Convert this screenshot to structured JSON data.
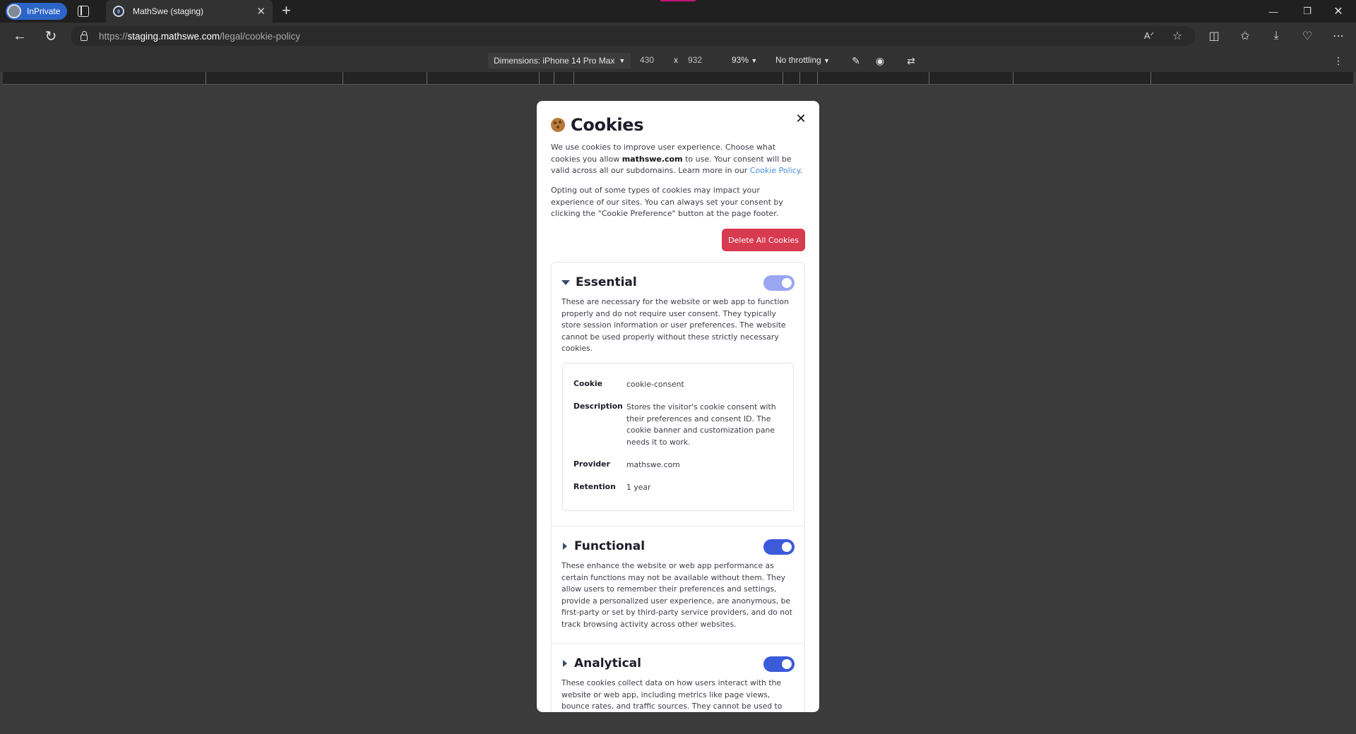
{
  "browser": {
    "profile_label": "InPrivate",
    "tab_title": "MathSwe (staging)",
    "url_scheme": "https://",
    "url_host": "staging.mathswe.com",
    "url_path": "/legal/cookie-policy"
  },
  "devtools": {
    "dimensions_label": "Dimensions: iPhone 14 Pro Max",
    "width": "430",
    "times": "x",
    "height": "932",
    "zoom": "93%",
    "throttling": "No throttling"
  },
  "modal": {
    "title": "Cookies",
    "intro_part1": "We use cookies to improve user experience. Choose what cookies you allow ",
    "intro_brand": "mathswe.com",
    "intro_part2": " to use. Your consent will be valid across all our subdomains. Learn more in our ",
    "intro_link": "Cookie Policy",
    "intro_end": ".",
    "optout_text": "Opting out of some types of cookies may impact your experience of our sites. You can always set your consent by clicking the \"Cookie Preference\" button at the page footer.",
    "delete_button": "Delete All Cookies",
    "sections": [
      {
        "title": "Essential",
        "enabled": true,
        "locked": true,
        "description": "These are necessary for the website or web app to function properly and do not require user consent. They typically store session information or user preferences. The website cannot be used properly without these strictly necessary cookies."
      },
      {
        "title": "Functional",
        "enabled": true,
        "locked": false,
        "description": "These enhance the website or web app performance as certain functions may not be available without them. They allow users to remember their preferences and settings, provide a personalized user experience, are anonymous, be first-party or set by third-party service providers, and do not track browsing activity across other websites."
      },
      {
        "title": "Analytical",
        "enabled": true,
        "locked": false,
        "description": "These cookies collect data on how users interact with the website or web app, including metrics like page views, bounce rates, and traffic sources. They cannot be used to"
      }
    ],
    "cookie_details": {
      "cookie_label": "Cookie",
      "cookie_value": "cookie-consent",
      "description_label": "Description",
      "description_value": "Stores the visitor's cookie consent with their preferences and consent ID. The cookie banner and customization pane needs it to work.",
      "provider_label": "Provider",
      "provider_value": "mathswe.com",
      "retention_label": "Retention",
      "retention_value": "1 year"
    }
  },
  "colors": {
    "delete_button": "#d83a4f",
    "toggle_on": "#3b5bdb",
    "toggle_locked": "#9aa6f0",
    "link": "#4a8fe0",
    "inprivate_badge": "#2c65c8"
  }
}
